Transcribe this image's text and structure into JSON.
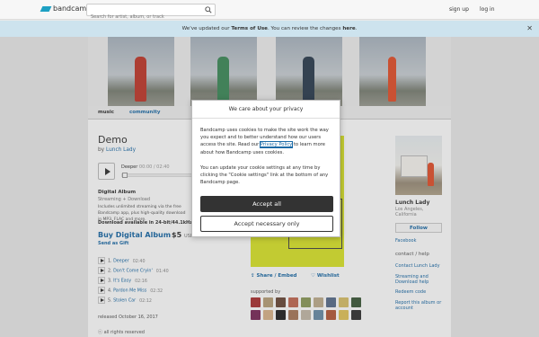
{
  "header": {
    "logo_text": "bandcamp",
    "search_placeholder": "Search for artist, album, or track",
    "signup": "sign up",
    "login": "log in"
  },
  "banner": {
    "text_pre": "We've updated our ",
    "terms": "Terms of Use",
    "text_mid": ". You can review the changes ",
    "here": "here",
    "text_end": ".",
    "close": "✕"
  },
  "tabs": {
    "music": "music",
    "community": "community"
  },
  "album": {
    "title": "Demo",
    "by": "by",
    "artist": "Lunch Lady",
    "player_track": "Deeper",
    "player_time": "00:00 / 02:40"
  },
  "digital": {
    "title": "Digital Album",
    "subtitle": "Streaming + Download",
    "desc": "Includes unlimited streaming via the free Bandcamp app, plus high-quality download in MP3, FLAC and more.",
    "bold": "Download available in 24-bit/44.1kHz.",
    "buy": "Buy Digital Album",
    "price": "$5",
    "currency": "USD",
    "gift": "Send as Gift"
  },
  "tracks": [
    {
      "num": "1.",
      "name": "Deeper",
      "dur": "02:40"
    },
    {
      "num": "2.",
      "name": "Don't Come Cryin'",
      "dur": "01:40"
    },
    {
      "num": "3.",
      "name": "It's Easy",
      "dur": "02:16"
    },
    {
      "num": "4.",
      "name": "Pardon Me Miss",
      "dur": "02:32"
    },
    {
      "num": "5.",
      "name": "Stolen Car",
      "dur": "02:12"
    }
  ],
  "released": "released October 16, 2017",
  "rights": "all rights reserved",
  "share": "Share / Embed",
  "wishlist": "Wishlist",
  "supported_by": "supported by",
  "sidebar": {
    "artist": "Lunch Lady",
    "location_city": "Los Angeles,",
    "location_state": "California",
    "follow": "Follow",
    "facebook": "Facebook",
    "contact_help": "contact / help",
    "contact": "Contact Lunch Lady",
    "streaming_help": "Streaming and Download help",
    "redeem": "Redeem code",
    "report": "Report this album or account"
  },
  "cookie": {
    "heading": "We care about your privacy",
    "text1_pre": "Bandcamp uses cookies to make the site work the way you expect and to better understand how our users access the site. Read our ",
    "privacy": "Privacy Policy",
    "text1_post": " to learn more about how Bandcamp uses cookies.",
    "text2": "You can update your cookie settings at any time by clicking the \"Cookie settings\" link at the bottom of any Bandcamp page.",
    "accept_all": "Accept all",
    "accept_necessary": "Accept necessary only"
  },
  "colors": {
    "accent": "#1a6aa7",
    "art": "#d9e42a",
    "banner": "#cde3ee"
  }
}
